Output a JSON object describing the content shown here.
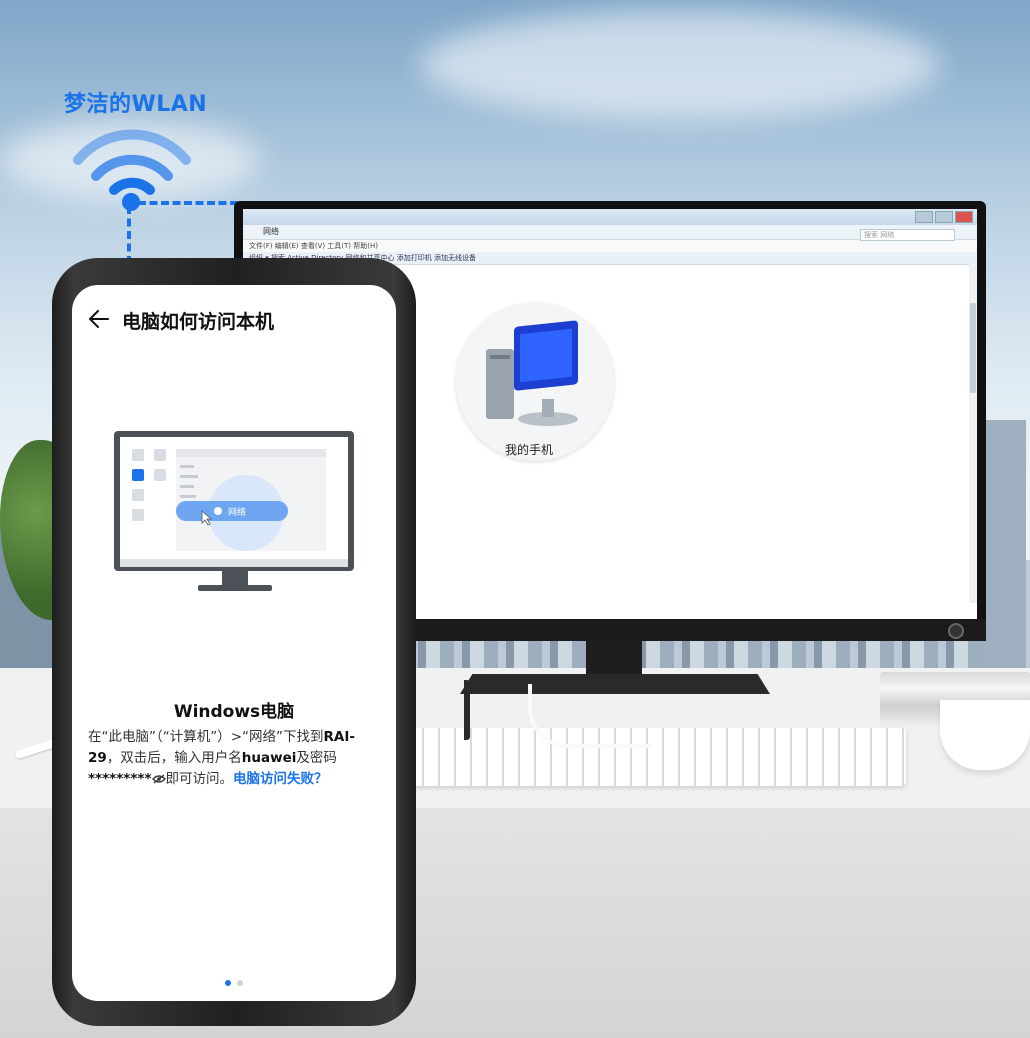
{
  "network": {
    "wlan_label": "梦洁的WLAN"
  },
  "computer": {
    "address_bar": "网络",
    "search_placeholder": "搜索 网络",
    "menu_bar": "文件(F)   编辑(E)   查看(V)   工具(T)   帮助(H)",
    "toolbar": "组织 ▾    搜索 Active Directory    网络和共享中心    添加打印机    添加无线设备",
    "device_label": "我的手机"
  },
  "phone": {
    "title": "电脑如何访问本机",
    "illustration_network_label": "网络",
    "os_title": "Windows电脑",
    "desc_1": "在“此电脑”（“计算机”）>“网络”下找到",
    "desc_device": "RAI-29",
    "desc_2": "，双击后，输入用户名",
    "desc_user": "huawei",
    "desc_3": "及密码",
    "desc_password": "*********",
    "desc_4": "即可访问。",
    "help_link": "电脑访问失败？",
    "page_index": 1,
    "page_count": 2
  },
  "colors": {
    "accent": "#1a73e8",
    "text": "#111111"
  },
  "icons": {
    "back": "arrow-left-icon",
    "password_visibility": "eye-off-icon",
    "wifi": "wifi-icon"
  }
}
